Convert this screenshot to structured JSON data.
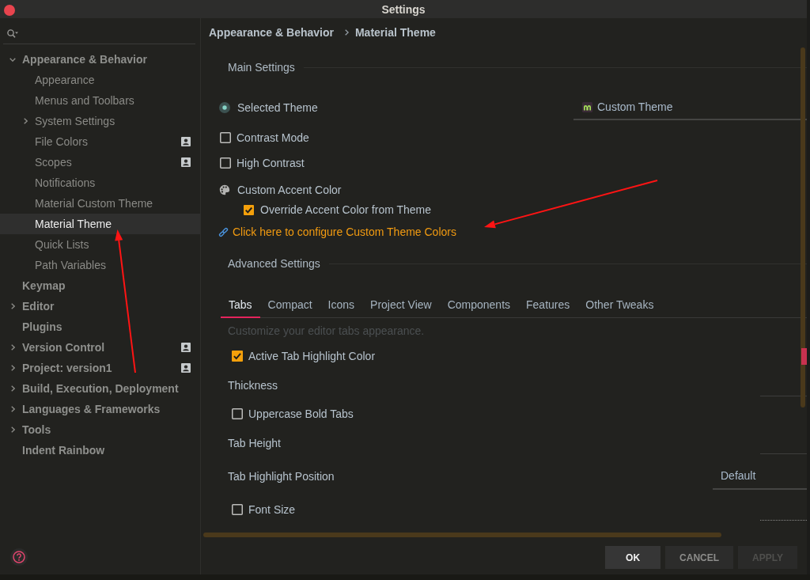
{
  "window": {
    "title": "Settings"
  },
  "sidebar": {
    "items": [
      {
        "label": "Appearance & Behavior",
        "expanded": true,
        "selected": false,
        "badge": false,
        "children": [
          {
            "label": "Appearance",
            "selected": false,
            "badge": false
          },
          {
            "label": "Menus and Toolbars",
            "selected": false,
            "badge": false
          },
          {
            "label": "System Settings",
            "expanded": false,
            "selected": false,
            "badge": false
          },
          {
            "label": "File Colors",
            "selected": false,
            "badge": true
          },
          {
            "label": "Scopes",
            "selected": false,
            "badge": true
          },
          {
            "label": "Notifications",
            "selected": false,
            "badge": false
          },
          {
            "label": "Material Custom Theme",
            "selected": false,
            "badge": false
          },
          {
            "label": "Material Theme",
            "selected": true,
            "badge": false
          },
          {
            "label": "Quick Lists",
            "selected": false,
            "badge": false
          },
          {
            "label": "Path Variables",
            "selected": false,
            "badge": false
          }
        ]
      },
      {
        "label": "Keymap",
        "selected": false,
        "badge": false
      },
      {
        "label": "Editor",
        "expanded": false,
        "selected": false,
        "badge": false
      },
      {
        "label": "Plugins",
        "selected": false,
        "badge": false
      },
      {
        "label": "Version Control",
        "expanded": false,
        "selected": false,
        "badge": true
      },
      {
        "label": "Project: version1",
        "expanded": false,
        "selected": false,
        "badge": true
      },
      {
        "label": "Build, Execution, Deployment",
        "expanded": false,
        "selected": false,
        "badge": false
      },
      {
        "label": "Languages & Frameworks",
        "expanded": false,
        "selected": false,
        "badge": false
      },
      {
        "label": "Tools",
        "expanded": false,
        "selected": false,
        "badge": false
      },
      {
        "label": "Indent Rainbow",
        "selected": false,
        "badge": false
      }
    ]
  },
  "breadcrumb": [
    "Appearance & Behavior",
    "Material Theme"
  ],
  "main_settings": {
    "title": "Main Settings",
    "rows": [
      {
        "kind": "radio",
        "label": "Selected Theme",
        "selected": true,
        "dropdown": {
          "value": "Custom Theme"
        }
      },
      {
        "kind": "checkbox",
        "label": "Contrast Mode",
        "checked": false
      },
      {
        "kind": "checkbox",
        "label": "High Contrast",
        "checked": false
      },
      {
        "kind": "group",
        "label": "Custom Accent Color",
        "children": [
          {
            "kind": "checkbox",
            "label": "Override Accent Color from Theme",
            "checked": true
          }
        ]
      },
      {
        "kind": "link",
        "label": "Click here to configure Custom Theme Colors"
      }
    ]
  },
  "advanced_settings": {
    "title": "Advanced Settings",
    "tabs": [
      {
        "label": "Tabs",
        "selected": true
      },
      {
        "label": "Compact",
        "selected": false
      },
      {
        "label": "Icons",
        "selected": false
      },
      {
        "label": "Project View",
        "selected": false
      },
      {
        "label": "Components",
        "selected": false
      },
      {
        "label": "Features",
        "selected": false
      },
      {
        "label": "Other Tweaks",
        "selected": false
      }
    ],
    "description": "Customize your editor tabs appearance.",
    "rows": [
      {
        "kind": "checkbox",
        "label": "Active Tab Highlight Color",
        "checked": true,
        "swatch": {
          "color": "#c8314f"
        }
      },
      {
        "kind": "field",
        "label": "Thickness",
        "field": {
          "kind": "number",
          "disabled": false
        }
      },
      {
        "kind": "checkbox",
        "label": "Uppercase Bold Tabs",
        "checked": false
      },
      {
        "kind": "field",
        "label": "Tab Height",
        "field": {
          "kind": "number",
          "disabled": false
        }
      },
      {
        "kind": "field",
        "label": "Tab Highlight Position",
        "field": {
          "kind": "select",
          "value": "Default"
        }
      },
      {
        "kind": "checkbox",
        "label": "Font Size",
        "checked": false,
        "field": {
          "kind": "number",
          "disabled": true
        }
      }
    ]
  },
  "buttons": [
    {
      "label": "OK",
      "default": true,
      "disabled": false
    },
    {
      "label": "CANCEL",
      "default": false,
      "disabled": false
    },
    {
      "label": "APPLY",
      "default": false,
      "disabled": true
    }
  ],
  "annotations": [
    {
      "kind": "arrow"
    },
    {
      "kind": "arrow"
    }
  ]
}
